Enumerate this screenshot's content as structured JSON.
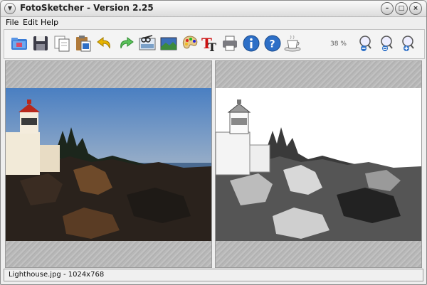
{
  "window": {
    "title": "FotoSketcher - Version 2.25"
  },
  "menu": {
    "file": "File",
    "edit": "Edit",
    "help": "Help"
  },
  "toolbar": {
    "zoom_level": "38 %"
  },
  "statusbar": {
    "text": "Lighthouse.jpg - 1024x768"
  },
  "colors": {
    "accent_blue": "#2d6fc7",
    "arrow_yellow": "#e8b400",
    "arrow_green": "#44aa44",
    "text_red": "#cc1111"
  }
}
